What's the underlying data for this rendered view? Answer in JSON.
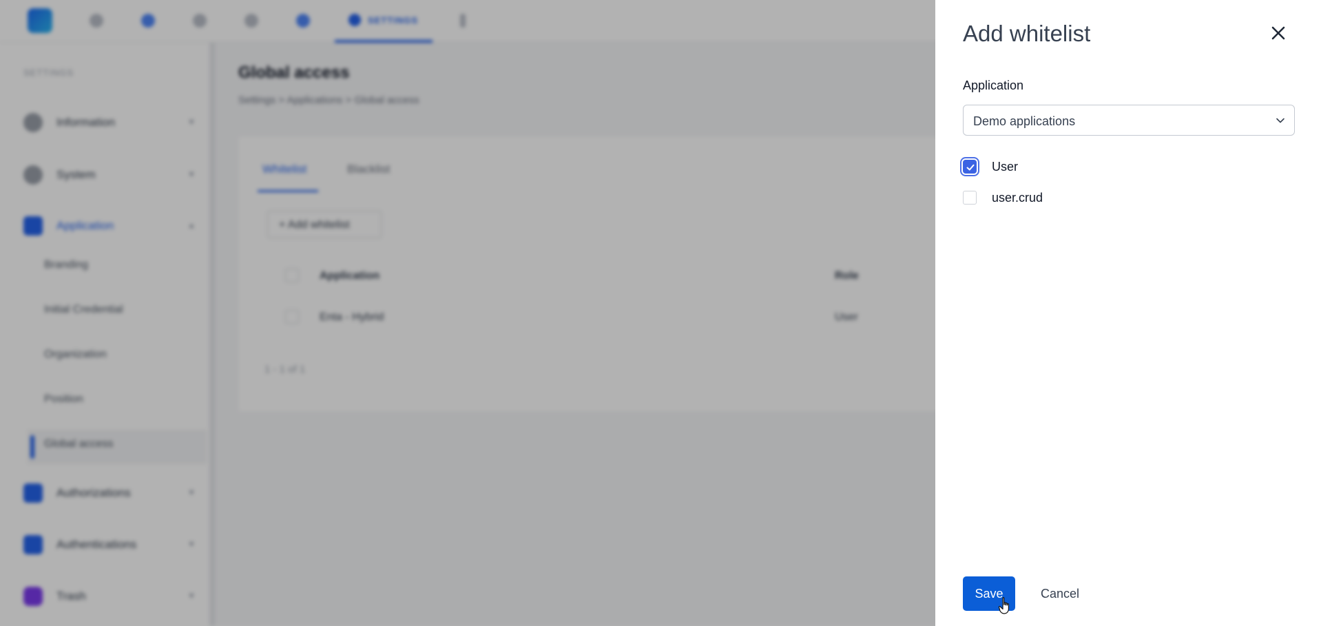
{
  "background_page": {
    "topnav": {
      "settings_label": "SETTINGS"
    },
    "sidebar": {
      "section_title": "SETTINGS",
      "items": [
        {
          "label": "Information",
          "icon": "info-icon"
        },
        {
          "label": "System",
          "icon": "monitor-icon"
        },
        {
          "label": "Application",
          "icon": "application-icon"
        },
        {
          "label": "Authorizations",
          "icon": "shield-icon"
        },
        {
          "label": "Authentications",
          "icon": "shield-icon"
        },
        {
          "label": "Trash",
          "icon": "trash-icon"
        }
      ],
      "subitems": [
        "Branding",
        "Initial Credential",
        "Organization",
        "Position",
        "Global access"
      ]
    },
    "header": {
      "title": "Global access",
      "breadcrumb": "Settings  >  Applications  >  Global access"
    },
    "tabs": [
      "Whitelist",
      "Blacklist"
    ],
    "add_button": "+  Add whitelist",
    "table": {
      "columns": [
        "Application",
        "Role"
      ],
      "rows": [
        {
          "application": "Enta - Hybrid",
          "role": "User"
        }
      ]
    },
    "pagination": "1 - 1 of 1"
  },
  "drawer": {
    "title": "Add whitelist",
    "application_label": "Application",
    "application_value": "Demo applications",
    "options": [
      {
        "label": "User",
        "checked": true
      },
      {
        "label": "user.crud",
        "checked": false
      }
    ],
    "save_label": "Save",
    "cancel_label": "Cancel"
  },
  "colors": {
    "primary": "#0b5ed7",
    "checkbox": "#3b63e3",
    "overlay": "rgba(0,0,0,0.30)"
  }
}
